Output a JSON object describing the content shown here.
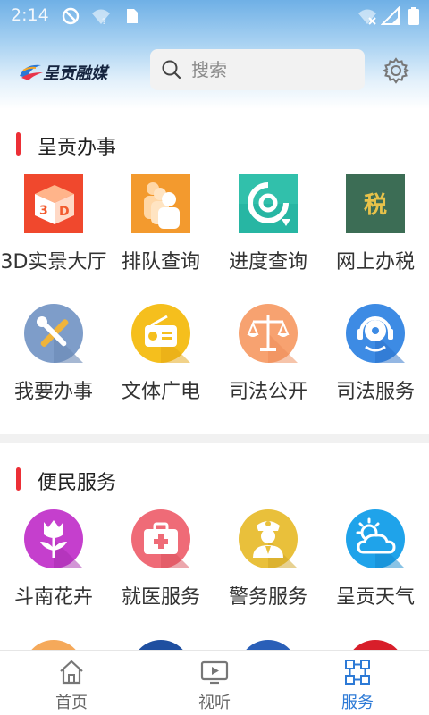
{
  "status_bar": {
    "time": "2:14"
  },
  "header": {
    "logo_text": "呈贡融媒",
    "search_placeholder": "搜索"
  },
  "sections": [
    {
      "title": "呈贡办事",
      "items": [
        {
          "label": "3D实景大厅",
          "icon": "3d-cube-icon"
        },
        {
          "label": "排队查询",
          "icon": "queue-people-icon"
        },
        {
          "label": "进度查询",
          "icon": "progress-refresh-icon"
        },
        {
          "label": "网上办税",
          "icon": "tax-icon",
          "glyph": "税"
        },
        {
          "label": "我要办事",
          "icon": "tools-icon"
        },
        {
          "label": "文体广电",
          "icon": "radio-icon"
        },
        {
          "label": "司法公开",
          "icon": "scales-icon"
        },
        {
          "label": "司法服务",
          "icon": "headset-service-icon"
        }
      ]
    },
    {
      "title": "便民服务",
      "items": [
        {
          "label": "斗南花卉",
          "icon": "flower-icon"
        },
        {
          "label": "就医服务",
          "icon": "medical-kit-icon"
        },
        {
          "label": "警务服务",
          "icon": "police-officer-icon"
        },
        {
          "label": "呈贡天气",
          "icon": "weather-sun-cloud-icon"
        }
      ]
    }
  ],
  "bottom_nav": [
    {
      "label": "首页",
      "icon": "home-icon",
      "active": false
    },
    {
      "label": "视听",
      "icon": "video-play-icon",
      "active": false
    },
    {
      "label": "服务",
      "icon": "services-grid-icon",
      "active": true
    }
  ],
  "colors": {
    "accent": "#2d7ad6",
    "section_bar": "#ec2f36",
    "header_top": "#6fb0e6"
  }
}
